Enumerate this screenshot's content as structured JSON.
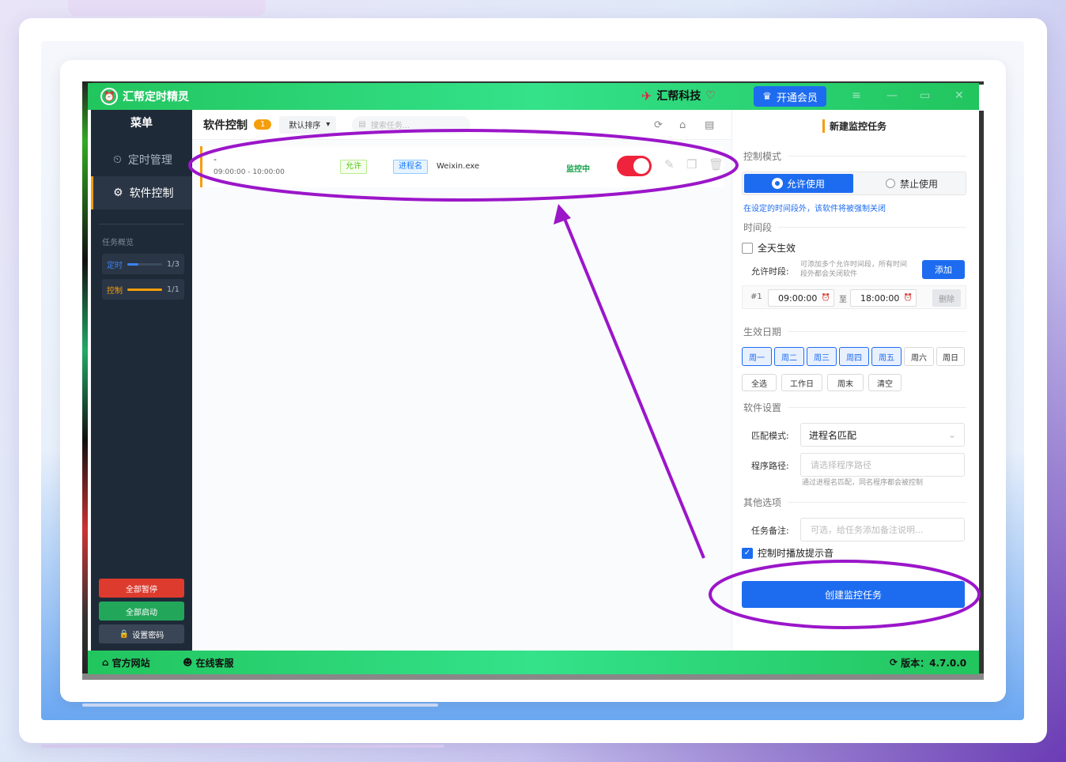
{
  "app": {
    "title": "汇帮定时精灵",
    "brand": "汇帮科技",
    "vip_button": "开通会员"
  },
  "sidebar": {
    "header": "菜单",
    "items": [
      {
        "label": "定时管理",
        "icon": "alarm-clock-icon"
      },
      {
        "label": "软件控制",
        "icon": "gear-icon"
      }
    ],
    "overview_label": "任务概览",
    "stats": [
      {
        "label": "定时",
        "value": "1/3",
        "fill": 0.33,
        "color": "#3b82f6"
      },
      {
        "label": "控制",
        "value": "1/1",
        "fill": 1.0,
        "color": "#f59e0b"
      }
    ],
    "buttons": {
      "pause_all": "全部暂停",
      "start_all": "全部启动",
      "set_password": "设置密码"
    }
  },
  "main": {
    "title": "软件控制",
    "count": "1",
    "sort": "默认排序",
    "search_placeholder": "搜索任务...",
    "tasks": [
      {
        "name": "-",
        "time": "09:00:00 - 10:00:00",
        "mode_tag": "允许",
        "match_tag": "进程名",
        "process": "Weixin.exe",
        "status": "监控中",
        "enabled": true
      }
    ]
  },
  "panel": {
    "title": "新建监控任务",
    "sec_mode": "控制模式",
    "mode_allow": "允许使用",
    "mode_deny": "禁止使用",
    "mode_hint": "在设定的时间段外，该软件将被强制关闭",
    "sec_time": "时间段",
    "all_day": "全天生效",
    "allow_period_label": "允许时段:",
    "allow_period_hint_1": "可添加多个允许时间段，所有时间",
    "allow_period_hint_2": "段外都会关闭软件",
    "add_button": "添加",
    "period": {
      "index": "#1",
      "start": "09:00:00",
      "to": "至",
      "end": "18:00:00",
      "delete": "删除"
    },
    "sec_days": "生效日期",
    "days": [
      {
        "label": "周一",
        "on": true
      },
      {
        "label": "周二",
        "on": true
      },
      {
        "label": "周三",
        "on": true
      },
      {
        "label": "周四",
        "on": true
      },
      {
        "label": "周五",
        "on": true
      },
      {
        "label": "周六",
        "on": false
      },
      {
        "label": "周日",
        "on": false
      }
    ],
    "quick": [
      "全选",
      "工作日",
      "周末",
      "清空"
    ],
    "sec_software": "软件设置",
    "match_label": "匹配模式:",
    "match_value": "进程名匹配",
    "path_label": "程序路径:",
    "path_placeholder": "请选择程序路径",
    "path_hint": "通过进程名匹配，同名程序都会被控制",
    "sec_other": "其他选项",
    "note_label": "任务备注:",
    "note_placeholder": "可选，给任务添加备注说明...",
    "sound_label": "控制时播放提示音",
    "sound_checked": true,
    "create_button": "创建监控任务"
  },
  "statusbar": {
    "website": "官方网站",
    "support": "在线客服",
    "version": "版本：4.7.0.0"
  },
  "annotation": {
    "color": "#9b16c9"
  }
}
